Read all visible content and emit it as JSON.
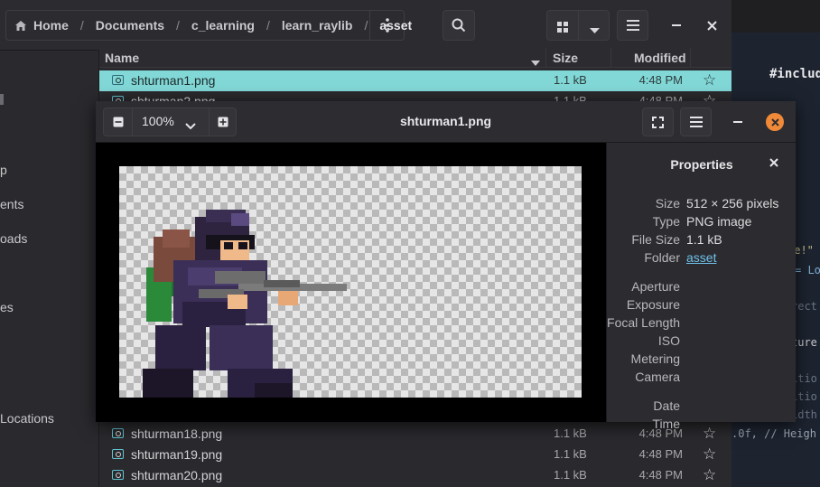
{
  "files": {
    "breadcrumb": [
      "Home",
      "Documents",
      "c_learning",
      "learn_raylib",
      "asset"
    ],
    "columns": {
      "name": "Name",
      "size": "Size",
      "modified": "Modified"
    },
    "sidebar_items": [
      "",
      "p",
      "ents",
      "oads",
      "es",
      "Locations"
    ],
    "rows_top": [
      {
        "name": "shturman1.png",
        "size": "1.1 kB",
        "modified": "4:48 PM"
      },
      {
        "name": "shturman2.png",
        "size": "1.1 kB",
        "modified": "4:48 PM"
      }
    ],
    "rows_bottom": [
      {
        "name": "shturman18.png",
        "size": "1.1 kB",
        "modified": "4:48 PM"
      },
      {
        "name": "shturman19.png",
        "size": "1.1 kB",
        "modified": "4:48 PM"
      },
      {
        "name": "shturman20.png",
        "size": "1.1 kB",
        "modified": "4:48 PM"
      }
    ]
  },
  "viewer": {
    "title": "shturman1.png",
    "zoom": "100%",
    "properties": {
      "heading": "Properties",
      "fields": [
        {
          "label": "Size",
          "value": "512 × 256 pixels"
        },
        {
          "label": "Type",
          "value": "PNG image"
        },
        {
          "label": "File Size",
          "value": "1.1 kB"
        },
        {
          "label": "Folder",
          "value": "asset",
          "link": true
        }
      ],
      "exif_labels": [
        "Aperture",
        "Exposure",
        "Focal Length",
        "ISO",
        "Metering",
        "Camera"
      ],
      "date_labels": [
        "Date",
        "Time"
      ]
    }
  },
  "editor": {
    "lines": [
      "#include",
      "me!\"",
      "= Lo",
      "rect",
      "ture",
      "itio",
      "itio",
      "idth",
      ".0f, // Heigh"
    ]
  },
  "colors": {
    "selection": "#82d7d7",
    "close_button": "#f08a38",
    "link": "#6fc0ea"
  }
}
